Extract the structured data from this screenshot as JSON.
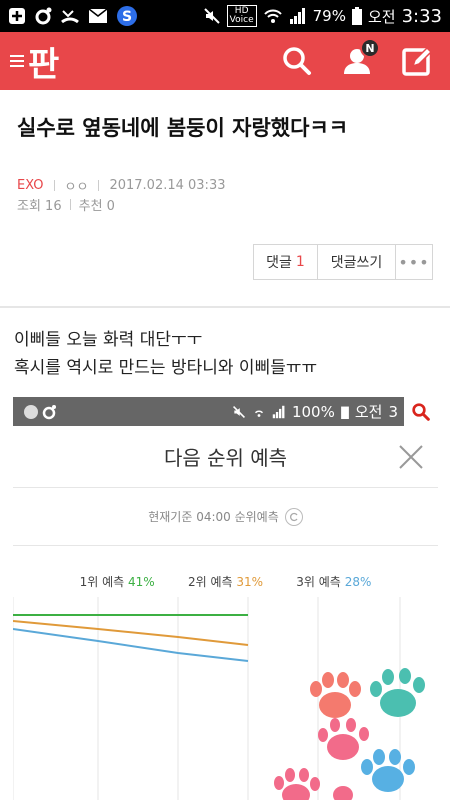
{
  "status_bar": {
    "hd_top": "HD",
    "hd_bottom": "Voice",
    "battery": "79%",
    "ampm": "오전",
    "time": "3:33"
  },
  "app_header": {
    "logo": "판",
    "icons": [
      "search-icon",
      "user-icon",
      "write-icon"
    ],
    "notification_badge": "N"
  },
  "post": {
    "title": "실수로 옆동네에 봄둥이 자랑했다ㅋㅋ",
    "author": "EXO",
    "author_extra": "ㅇㅇ",
    "date": "2017.02.14 03:33",
    "views_label": "조회 16",
    "recommend_label": "추천 0",
    "comment_label": "댓글",
    "comment_count": "1",
    "write_comment_label": "댓글쓰기",
    "more_label": "•••",
    "body_lines": [
      "이삐들 오늘 화력 대단ㅜㅜ",
      "혹시를 역시로 만드는 방타니와 이삐들ㅠㅠ"
    ]
  },
  "embedded_image": {
    "status_battery": "100%",
    "status_ampm": "오전",
    "status_time": "3",
    "title": "다음 순위 예측",
    "subtitle": "현재기준 04:00 순위예측",
    "legend": [
      {
        "label": "1위 예측",
        "value": "41%",
        "color": "#3cb043"
      },
      {
        "label": "2위 예측",
        "value": "31%",
        "color": "#e09a3a"
      },
      {
        "label": "3위 예측",
        "value": "28%",
        "color": "#5aa8d8"
      }
    ]
  },
  "colors": {
    "accent": "#e8474a",
    "paw_pink": "#f26b8a",
    "paw_teal": "#4bbfb0",
    "paw_blue": "#57b0e3",
    "paw_coral": "#f47a6e"
  }
}
